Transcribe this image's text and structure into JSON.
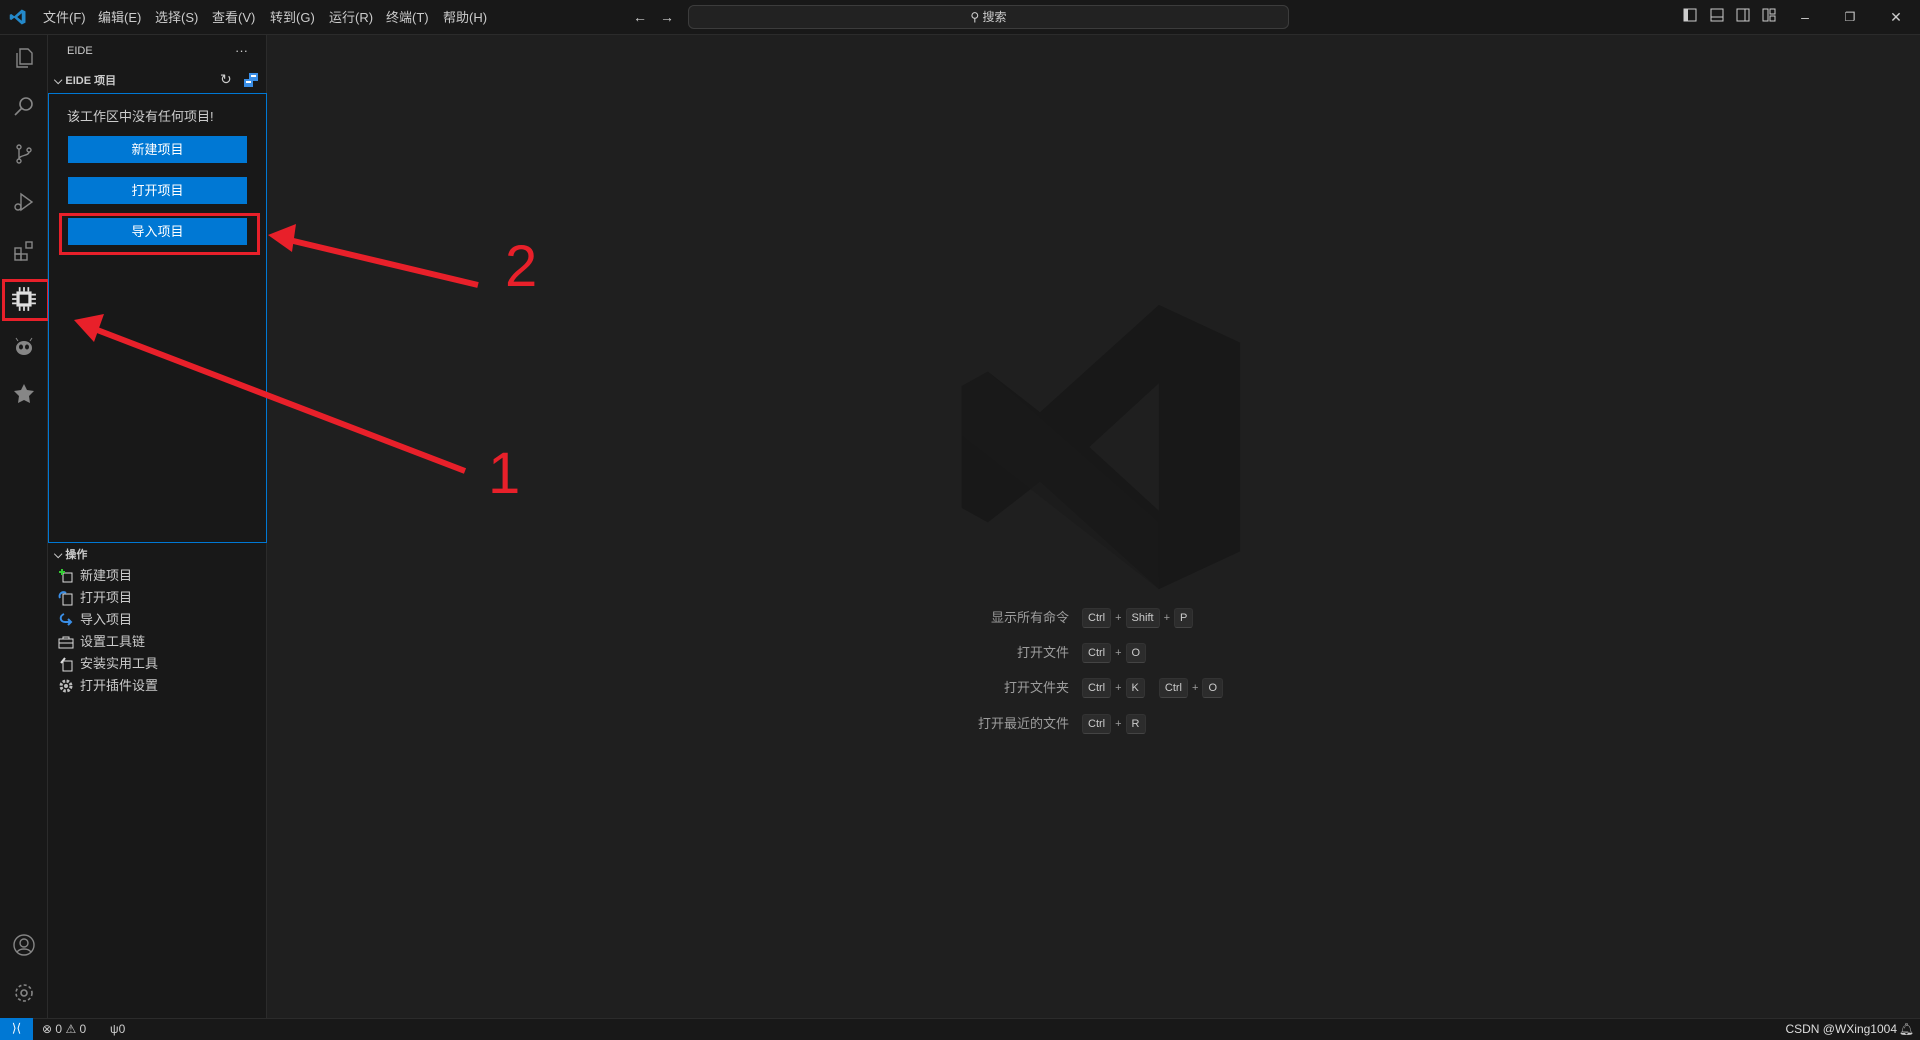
{
  "titlebar": {
    "menus": [
      "文件(F)",
      "编辑(E)",
      "选择(S)",
      "查看(V)",
      "转到(G)",
      "运行(R)",
      "终端(T)",
      "帮助(H)"
    ],
    "search_label": "搜索"
  },
  "sidebar": {
    "title": "EIDE",
    "more": "···",
    "projects_section": "EIDE 项目",
    "empty_message": "该工作区中没有任何项目!",
    "buttons": [
      "新建项目",
      "打开项目",
      "导入项目"
    ],
    "operations_section": "操作",
    "operations": [
      "新建项目",
      "打开项目",
      "导入项目",
      "设置工具链",
      "安装实用工具",
      "打开插件设置"
    ]
  },
  "shortcuts": [
    {
      "label": "显示所有命令",
      "keys": [
        "Ctrl",
        "+",
        "Shift",
        "+",
        "P"
      ]
    },
    {
      "label": "打开文件",
      "keys": [
        "Ctrl",
        "+",
        "O"
      ]
    },
    {
      "label": "打开文件夹",
      "keys": [
        "Ctrl",
        "+",
        "K",
        " ",
        "Ctrl",
        "+",
        "O"
      ]
    },
    {
      "label": "打开最近的文件",
      "keys": [
        "Ctrl",
        "+",
        "R"
      ]
    }
  ],
  "annotations": {
    "one": "1",
    "two": "2"
  },
  "statusbar": {
    "errors": "0",
    "warnings": "0",
    "ports": "0",
    "watermark": "CSDN @WXing1004"
  },
  "colors": {
    "accent": "#0078d4",
    "annotation": "#e8202a"
  }
}
